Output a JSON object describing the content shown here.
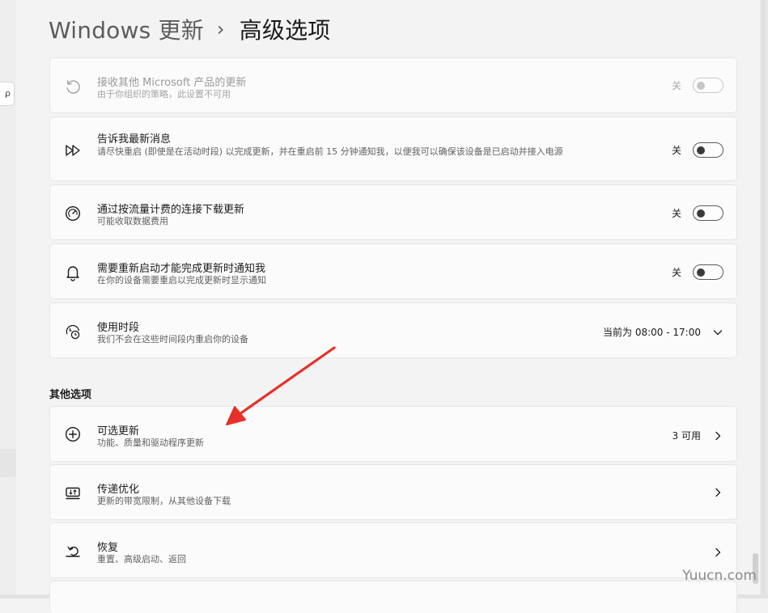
{
  "breadcrumb": {
    "parent": "Windows 更新",
    "separator": "›",
    "current": "高级选项"
  },
  "settings": [
    {
      "title": "接收其他 Microsoft 产品的更新",
      "desc": "由于你组织的策略，此设置不可用",
      "state": "关",
      "icon": "refresh-icon"
    },
    {
      "title": "告诉我最新消息",
      "desc": "请尽快重启 (即使是在活动时段) 以完成更新，并在重启前 15 分钟通知我，以便我可以确保该设备是已启动并接入电源",
      "state": "关",
      "icon": "fast-forward-icon"
    },
    {
      "title": "通过按流量计费的连接下载更新",
      "desc": "可能收取数据费用",
      "state": "关",
      "icon": "gauge-icon"
    },
    {
      "title": "需要重新启动才能完成更新时通知我",
      "desc": "在你的设备需要重启以完成更新时显示通知",
      "state": "关",
      "icon": "bell-icon"
    },
    {
      "title": "使用时段",
      "desc": "我们不会在这些时间段内重启你的设备",
      "value": "当前为 08:00 - 17:00",
      "icon": "clock-icon"
    }
  ],
  "other_options": {
    "header": "其他选项",
    "items": [
      {
        "title": "可选更新",
        "desc": "功能、质量和驱动程序更新",
        "value": "3 可用",
        "icon": "add-circle-icon"
      },
      {
        "title": "传递优化",
        "desc": "更新的带宽限制，从其他设备下载",
        "icon": "delivery-icon"
      },
      {
        "title": "恢复",
        "desc": "重置、高级启动、返回",
        "icon": "recovery-icon"
      }
    ]
  },
  "watermark": "Yuucn.com",
  "colors": {
    "annotation_arrow": "#e8302a",
    "toggle_off": "#3a3a3a",
    "card_bg": "#fbfbfb"
  }
}
